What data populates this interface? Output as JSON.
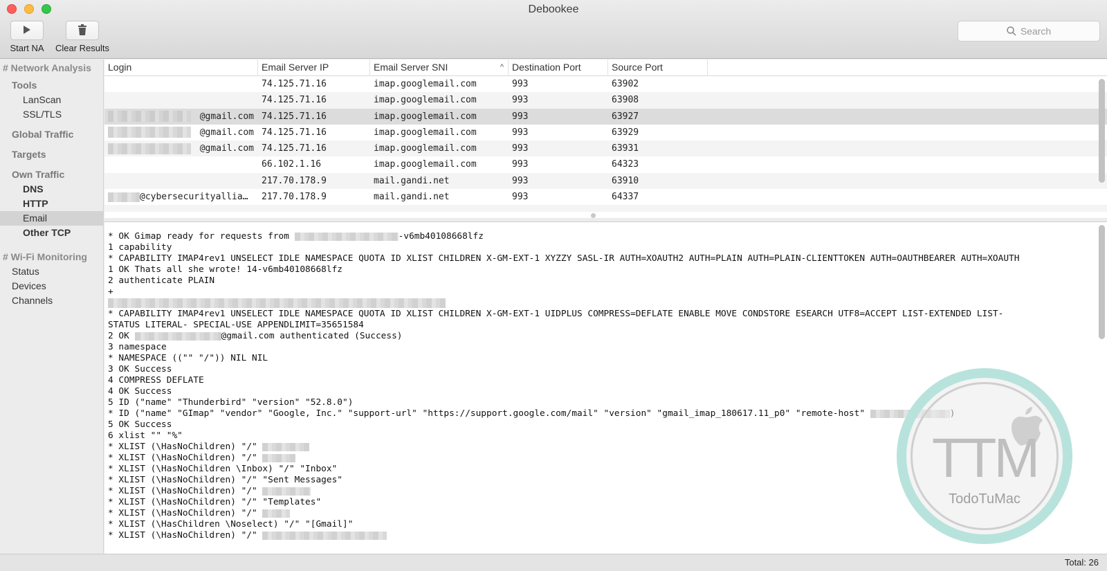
{
  "window": {
    "title": "Debookee"
  },
  "toolbar": {
    "start_label": "Start NA",
    "start_icon": "play-icon",
    "clear_label": "Clear Results",
    "clear_icon": "trash-icon",
    "search_placeholder": "Search"
  },
  "sidebar": {
    "network_analysis": "# Network Analysis",
    "tools": "Tools",
    "lanscan": "LanScan",
    "ssltls": "SSL/TLS",
    "global_traffic": "Global Traffic",
    "targets": "Targets",
    "own_traffic": "Own Traffic",
    "dns": "DNS",
    "http": "HTTP",
    "email": "Email",
    "other_tcp": "Other TCP",
    "wifi_monitoring": "# Wi-Fi Monitoring",
    "status": "Status",
    "devices": "Devices",
    "channels": "Channels"
  },
  "table": {
    "columns": [
      "Login",
      "Email Server IP",
      "Email Server SNI",
      "Destination Port",
      "Source Port"
    ],
    "sort_indicator": "^",
    "rows": [
      {
        "login": "",
        "ip": "74.125.71.16",
        "sni": "imap.googlemail.com",
        "dport": "993",
        "sport": "63902"
      },
      {
        "login": "",
        "ip": "74.125.71.16",
        "sni": "imap.googlemail.com",
        "dport": "993",
        "sport": "63908"
      },
      {
        "login": "@gmail.com",
        "ip": "74.125.71.16",
        "sni": "imap.googlemail.com",
        "dport": "993",
        "sport": "63927"
      },
      {
        "login": "@gmail.com",
        "ip": "74.125.71.16",
        "sni": "imap.googlemail.com",
        "dport": "993",
        "sport": "63929"
      },
      {
        "login": "@gmail.com",
        "ip": "74.125.71.16",
        "sni": "imap.googlemail.com",
        "dport": "993",
        "sport": "63931"
      },
      {
        "login": "",
        "ip": "66.102.1.16",
        "sni": "imap.googlemail.com",
        "dport": "993",
        "sport": "64323"
      },
      {
        "login": "",
        "ip": "217.70.178.9",
        "sni": "mail.gandi.net",
        "dport": "993",
        "sport": "63910"
      },
      {
        "login": "@cybersecurityallia…",
        "ip": "217.70.178.9",
        "sni": "mail.gandi.net",
        "dport": "993",
        "sport": "64337"
      }
    ]
  },
  "log": {
    "lines": [
      "* OK Gimap ready for requests from ",
      "-v6mb40108668lfz",
      "1 capability",
      "* CAPABILITY IMAP4rev1 UNSELECT IDLE NAMESPACE QUOTA ID XLIST CHILDREN X-GM-EXT-1 XYZZY SASL-IR AUTH=XOAUTH2 AUTH=PLAIN AUTH=PLAIN-CLIENTTOKEN AUTH=OAUTHBEARER AUTH=XOAUTH",
      "1 OK Thats all she wrote! 14-v6mb40108668lfz",
      "2 authenticate PLAIN",
      "+",
      "* CAPABILITY IMAP4rev1 UNSELECT IDLE NAMESPACE QUOTA ID XLIST CHILDREN X-GM-EXT-1 UIDPLUS COMPRESS=DEFLATE ENABLE MOVE CONDSTORE ESEARCH UTF8=ACCEPT LIST-EXTENDED LIST-",
      "STATUS LITERAL- SPECIAL-USE APPENDLIMIT=35651584",
      "2 OK ",
      "@gmail.com authenticated (Success)",
      "3 namespace",
      "* NAMESPACE ((\"\" \"/\")) NIL NIL",
      "3 OK Success",
      "4 COMPRESS DEFLATE",
      "4 OK Success",
      "5 ID (\"name\" \"Thunderbird\" \"version\" \"52.8.0\")",
      "* ID (\"name\" \"GImap\" \"vendor\" \"Google, Inc.\" \"support-url\" \"https://support.google.com/mail\" \"version\" \"gmail_imap_180617.11_p0\" \"remote-host\" ",
      ")",
      "5 OK Success",
      "6 xlist \"\" \"%\"",
      "* XLIST (\\HasNoChildren) \"/\" ",
      "* XLIST (\\HasNoChildren) \"/\" ",
      "* XLIST (\\HasNoChildren \\Inbox) \"/\" \"Inbox\"",
      "* XLIST (\\HasNoChildren) \"/\" \"Sent Messages\"",
      "* XLIST (\\HasNoChildren) \"/\" ",
      "* XLIST (\\HasNoChildren) \"/\" \"Templates\"",
      "* XLIST (\\HasNoChildren) \"/\" ",
      "* XLIST (\\HasChildren \\Noselect) \"/\" \"[Gmail]\"",
      "* XLIST (\\HasNoChildren) \"/\" "
    ]
  },
  "watermark": {
    "logo_text": "TTM",
    "brand": "TodoTuMac"
  },
  "status": {
    "total": "Total: 26"
  }
}
